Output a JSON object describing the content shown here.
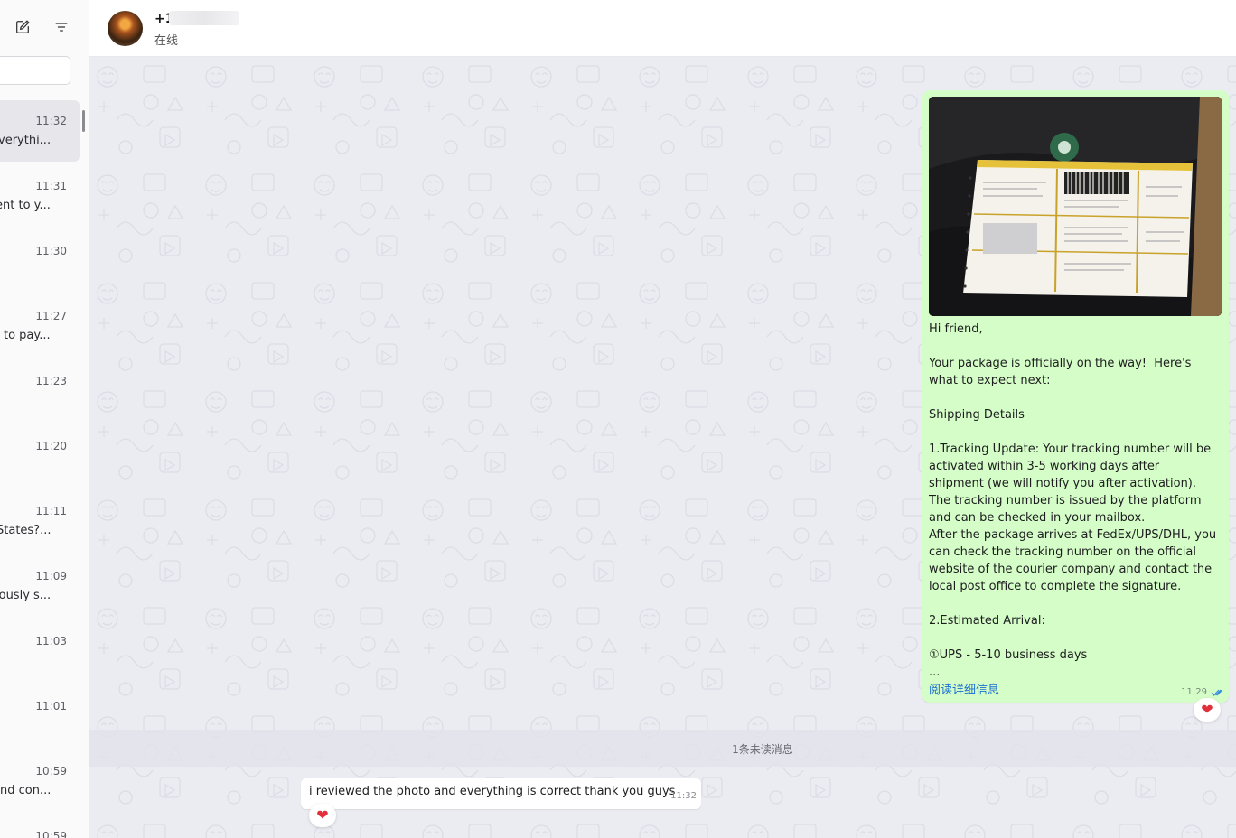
{
  "sidebar": {
    "chats": [
      {
        "time": "11:32",
        "snippet": "everythi..."
      },
      {
        "time": "11:31",
        "snippet": "ent to y..."
      },
      {
        "time": "11:30",
        "snippet": ""
      },
      {
        "time": "11:27",
        "snippet": "to pay..."
      },
      {
        "time": "11:23",
        "snippet": ""
      },
      {
        "time": "11:20",
        "snippet": ""
      },
      {
        "time": "11:11",
        "snippet": "States?..."
      },
      {
        "time": "11:09",
        "snippet": "iously s..."
      },
      {
        "time": "11:03",
        "snippet": ""
      },
      {
        "time": "11:01",
        "snippet": ""
      },
      {
        "time": "10:59",
        "snippet": "and con..."
      },
      {
        "time": "10:59",
        "snippet": ""
      }
    ]
  },
  "header": {
    "contact_name": "+1",
    "status": "在线"
  },
  "messages": {
    "outgoing": {
      "text": "Hi friend,\n\nYour package is officially on the way!  Here's what to expect next:\n\nShipping Details\n\n1.Tracking Update: Your tracking number will be activated within 3-5 working days after shipment (we will notify you after activation). The tracking number is issued by the platform and can be checked in your mailbox.\nAfter the package arrives at FedEx/UPS/DHL, you can check the tracking number on the official website of the courier company and contact the local post office to complete the signature.\n\n2.Estimated Arrival:\n\n①UPS - 5-10 business days\n...",
      "read_more": "阅读详细信息",
      "time": "11:29",
      "reaction": "❤"
    },
    "unread_divider": "1条未读消息",
    "incoming": {
      "text": "i reviewed the photo and everything is correct thank you guys",
      "time": "11:32",
      "reaction": "❤"
    }
  },
  "colors": {
    "outgoing_bubble": "#d5fdc8",
    "incoming_bubble": "#ffffff",
    "link": "#1a6fd1",
    "read_ticks": "#2f8ae0",
    "reaction_heart": "#e0303b"
  }
}
